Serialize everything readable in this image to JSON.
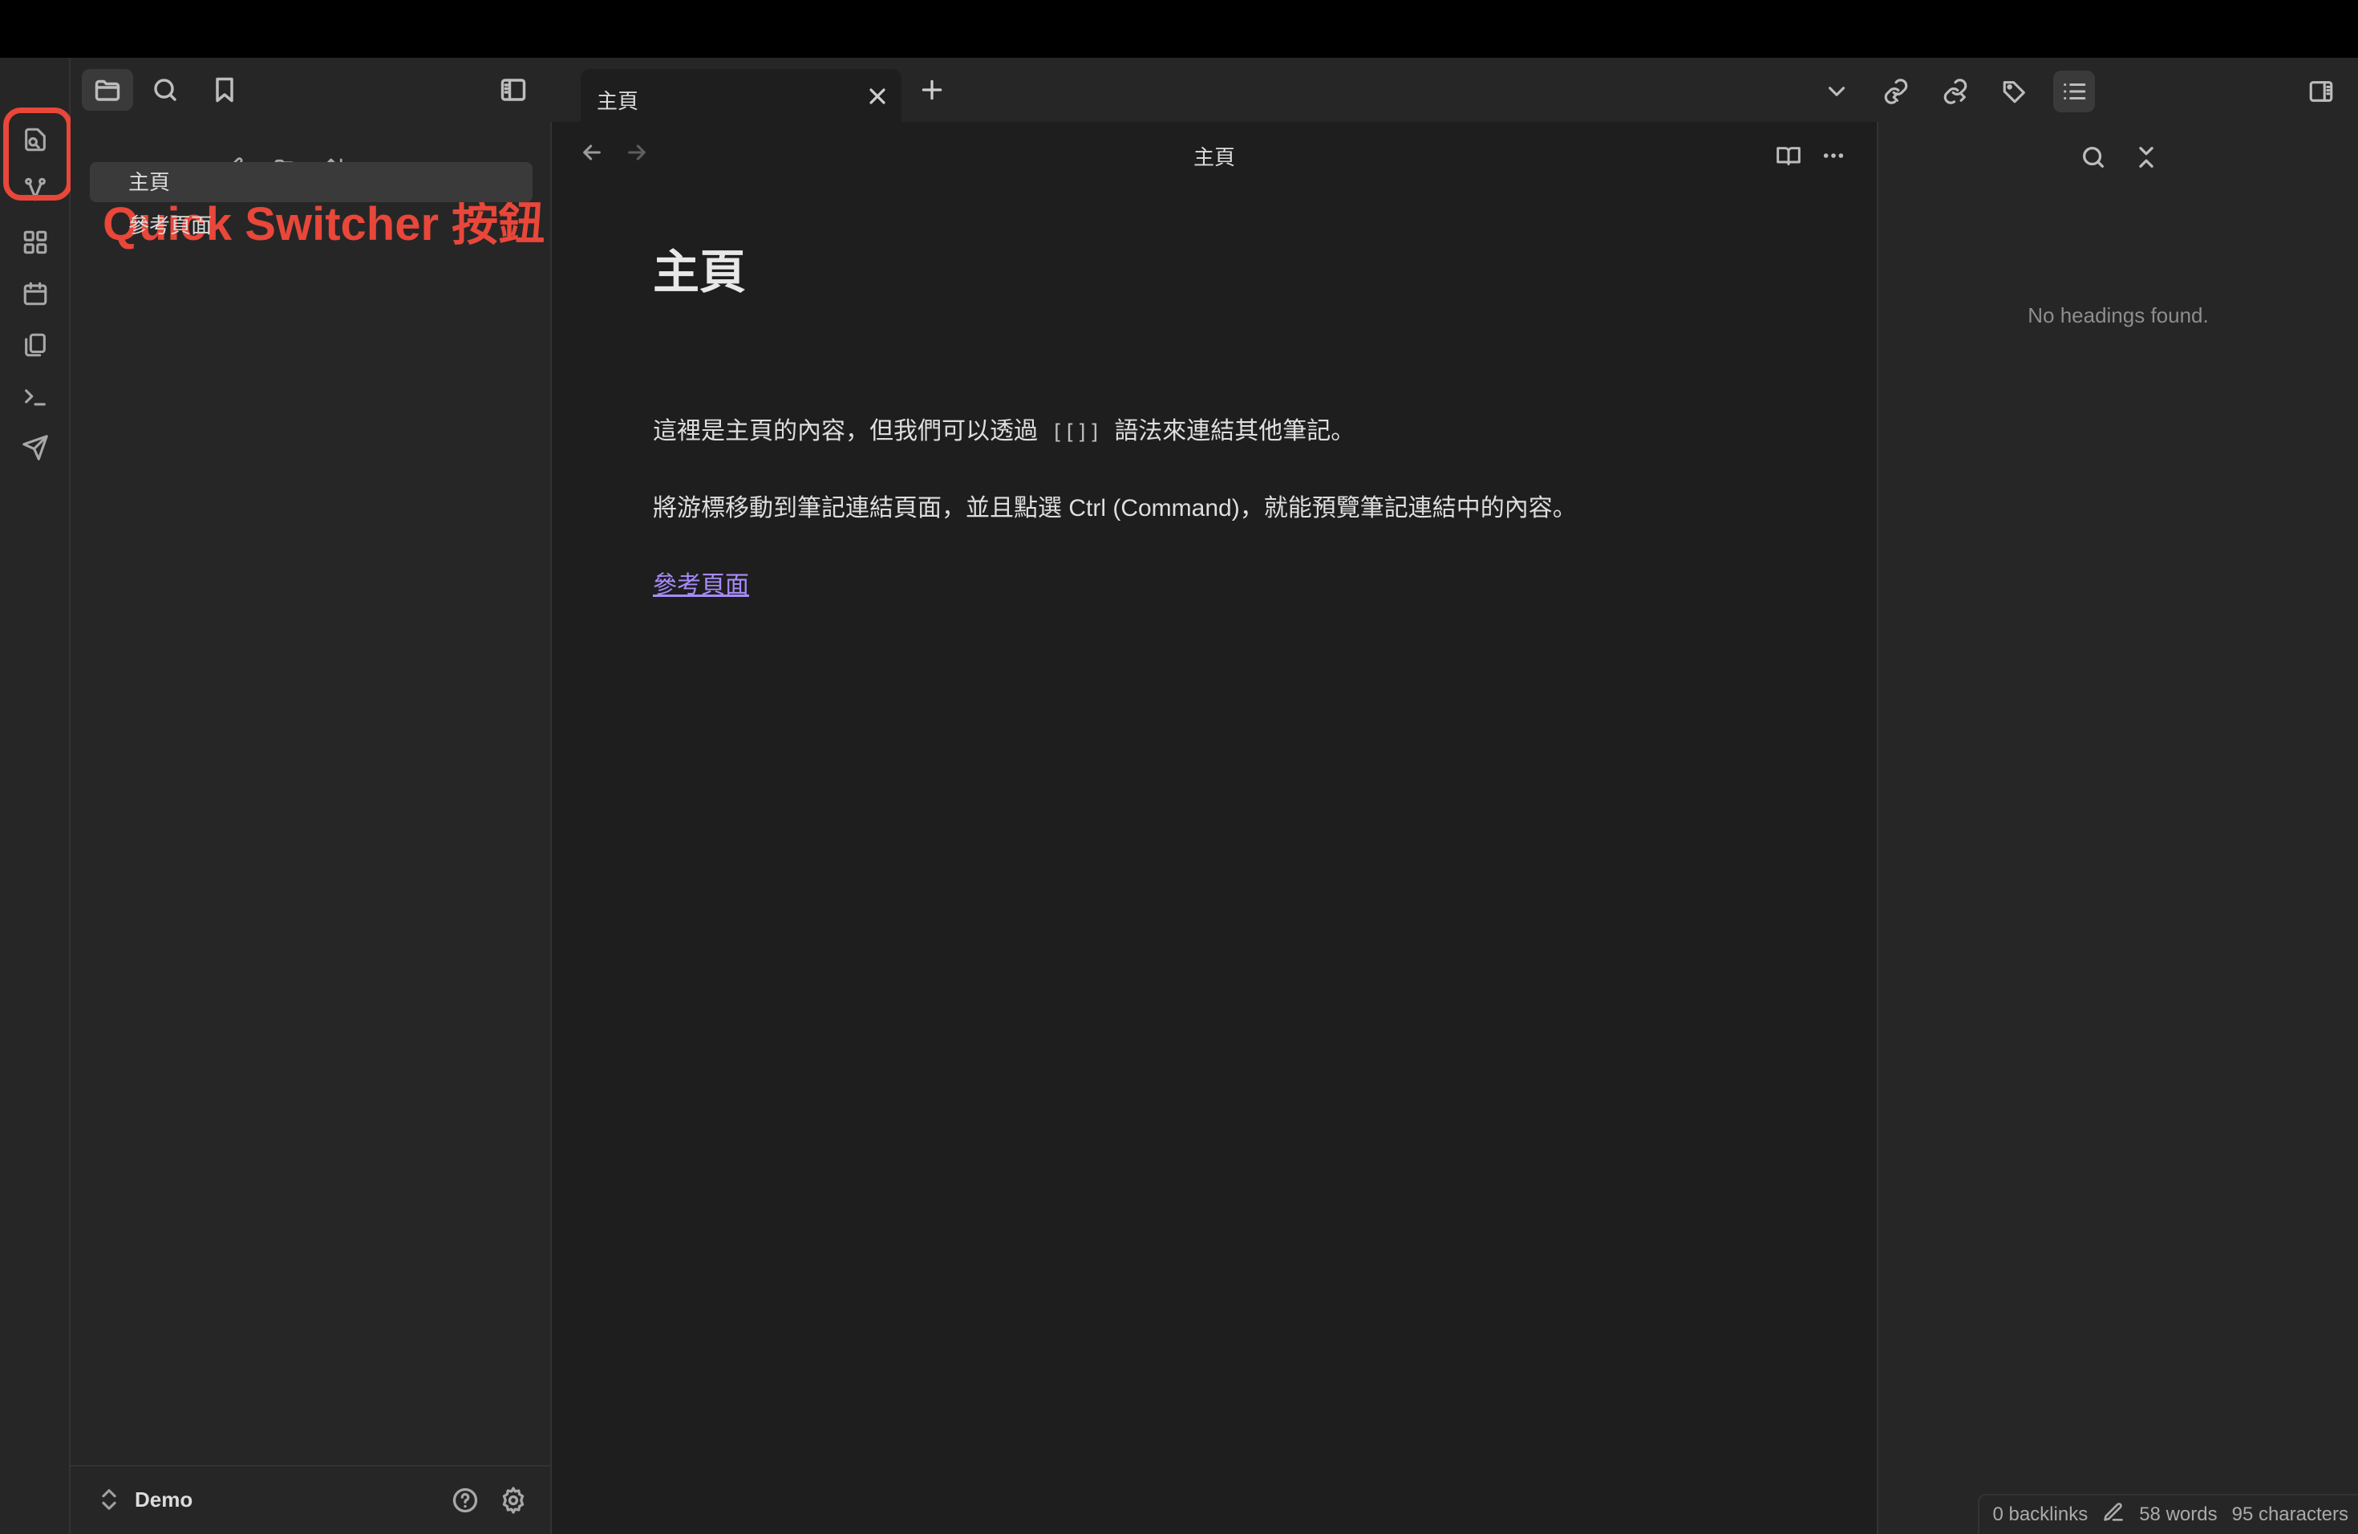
{
  "annotation": {
    "text": "Quick Switcher 按鈕",
    "color": "#e8473a"
  },
  "left_sidebar": {
    "files": [
      {
        "label": "主頁",
        "active": true
      },
      {
        "label": "參考頁面",
        "active": false
      }
    ],
    "vault_name": "Demo"
  },
  "tab": {
    "title": "主頁"
  },
  "editor": {
    "header_title": "主頁",
    "heading": "主頁",
    "para1_before": "這裡是主頁的內容，但我們可以透過",
    "para1_code": "[[]]",
    "para1_after": "語法來連結其他筆記。",
    "para2": "將游標移動到筆記連結頁面，並且點選 Ctrl (Command)，就能預覽筆記連結中的內容。",
    "link": "參考頁面",
    "link_color": "#a88bfa"
  },
  "outline": {
    "empty_text": "No headings found."
  },
  "status": {
    "backlinks": "0 backlinks",
    "words": "58 words",
    "characters": "95 characters"
  },
  "icons": {
    "ribbon": [
      "quick-switcher-icon",
      "graph-icon",
      "canvas-icon",
      "calendar-icon",
      "templates-icon",
      "command-palette-icon",
      "publish-icon"
    ],
    "left_header": [
      "folder-icon",
      "search-icon",
      "bookmark-icon",
      "sidebar-toggle-icon"
    ],
    "tabbar": [
      "chevron-down-icon",
      "backlinks-icon",
      "outgoing-links-icon",
      "tags-icon",
      "outline-icon",
      "right-sidebar-toggle-icon"
    ]
  }
}
